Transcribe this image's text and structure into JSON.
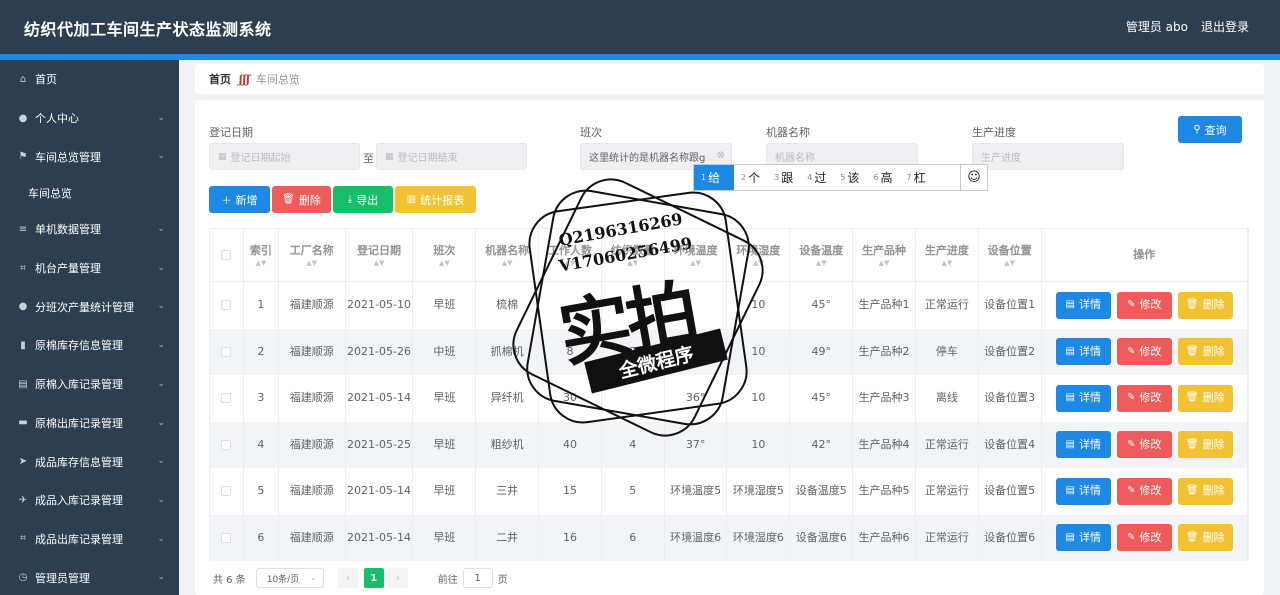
{
  "app": {
    "title": "纺织代加工车间生产状态监测系统",
    "user": "管理员 abo",
    "logout": "退出登录"
  },
  "sidebar": {
    "items": [
      {
        "label": "首页",
        "icon": "home-icon",
        "glyph": "⌂",
        "arrow": false,
        "sub": false
      },
      {
        "label": "个人中心",
        "icon": "user-icon",
        "glyph": "●",
        "arrow": true,
        "sub": false
      },
      {
        "label": "车间总览管理",
        "icon": "flag-icon",
        "glyph": "⚑",
        "arrow": true,
        "sub": false
      },
      {
        "label": "车间总览",
        "icon": "",
        "glyph": "",
        "arrow": false,
        "sub": true
      },
      {
        "label": "单机数据管理",
        "icon": "list-icon",
        "glyph": "≡",
        "arrow": true,
        "sub": false
      },
      {
        "label": "机台产量管理",
        "icon": "crop-icon",
        "glyph": "⌗",
        "arrow": true,
        "sub": false
      },
      {
        "label": "分班次产量统计管理",
        "icon": "user-icon",
        "glyph": "●",
        "arrow": true,
        "sub": false
      },
      {
        "label": "原棉库存信息管理",
        "icon": "mic-icon",
        "glyph": "▮",
        "arrow": true,
        "sub": false
      },
      {
        "label": "原棉入库记录管理",
        "icon": "cart-icon",
        "glyph": "▤",
        "arrow": true,
        "sub": false
      },
      {
        "label": "原棉出库记录管理",
        "icon": "chat-icon",
        "glyph": "▬",
        "arrow": true,
        "sub": false
      },
      {
        "label": "成品库存信息管理",
        "icon": "send-icon",
        "glyph": "➤",
        "arrow": true,
        "sub": false
      },
      {
        "label": "成品入库记录管理",
        "icon": "plane-icon",
        "glyph": "✈",
        "arrow": true,
        "sub": false
      },
      {
        "label": "成品出库记录管理",
        "icon": "crop-icon",
        "glyph": "⌗",
        "arrow": true,
        "sub": false
      },
      {
        "label": "管理员管理",
        "icon": "clock-icon",
        "glyph": "◷",
        "arrow": true,
        "sub": false
      }
    ],
    "arrow_glyph": "⌄"
  },
  "breadcrumb": {
    "home": "首页",
    "sep": "ʃʃʃ",
    "current": "车间总览"
  },
  "filters": {
    "date_label": "登记日期",
    "date_start_placeholder": "登记日期起始",
    "date_to": "至",
    "date_end_placeholder": "登记日期结束",
    "shift_label": "班次",
    "shift_value": "这里统计的是机器名称跟g",
    "machine_label": "机器名称",
    "machine_placeholder": "机器名称",
    "progress_label": "生产进度",
    "progress_placeholder": "生产进度",
    "query": "查询"
  },
  "ime": {
    "candidates": [
      {
        "n": "1",
        "t": "给"
      },
      {
        "n": "2",
        "t": "个"
      },
      {
        "n": "3",
        "t": "跟"
      },
      {
        "n": "4",
        "t": "过"
      },
      {
        "n": "5",
        "t": "该"
      },
      {
        "n": "6",
        "t": "高"
      },
      {
        "n": "7",
        "t": "杠"
      }
    ],
    "emoji": "☺"
  },
  "toolbar": {
    "add": "新增",
    "delete": "删除",
    "export": "导出",
    "report": "统计报表"
  },
  "table": {
    "columns": [
      "索引",
      "工厂名称",
      "登记日期",
      "班次",
      "机器名称",
      "工作人数",
      "纺织数量",
      "环境温度",
      "环境湿度",
      "设备温度",
      "生产品种",
      "生产进度",
      "设备位置",
      "操作"
    ],
    "rows": [
      [
        "1",
        "福建顺源",
        "2021-05-10",
        "早班",
        "梳棉",
        "",
        "2",
        "",
        "10",
        "45°",
        "生产品种1",
        "正常运行",
        "设备位置1"
      ],
      [
        "2",
        "福建顺源",
        "2021-05-26",
        "中班",
        "抓棉机",
        "8",
        "3",
        "",
        "10",
        "49°",
        "生产品种2",
        "停车",
        "设备位置2"
      ],
      [
        "3",
        "福建顺源",
        "2021-05-14",
        "早班",
        "异纤机",
        "30",
        "",
        "36°",
        "10",
        "45°",
        "生产品种3",
        "离线",
        "设备位置3"
      ],
      [
        "4",
        "福建顺源",
        "2021-05-25",
        "早班",
        "粗纱机",
        "40",
        "4",
        "37°",
        "10",
        "42°",
        "生产品种4",
        "正常运行",
        "设备位置4"
      ],
      [
        "5",
        "福建顺源",
        "2021-05-14",
        "早班",
        "三井",
        "15",
        "5",
        "环境温度5",
        "环境湿度5",
        "设备温度5",
        "生产品种5",
        "正常运行",
        "设备位置5"
      ],
      [
        "6",
        "福建顺源",
        "2021-05-14",
        "早班",
        "二井",
        "16",
        "6",
        "环境温度6",
        "环境湿度6",
        "设备温度6",
        "生产品种6",
        "正常运行",
        "设备位置6"
      ]
    ],
    "actions": {
      "detail": "详情",
      "edit": "修改",
      "delete": "删除"
    }
  },
  "pagination": {
    "total": "共 6 条",
    "page_size": "10条/页",
    "prev": "‹",
    "current": "1",
    "next": "›",
    "goto_label": "前往",
    "goto_value": "1",
    "page_suffix": "页"
  },
  "watermark": {
    "qq": "Q2196316269",
    "vx": "V17060256499",
    "big": "实拍",
    "ribbon": "全微程序"
  },
  "colors": {
    "header": "#2c3e50",
    "accent": "#1e88e5",
    "danger": "#ef5b5b",
    "success": "#19be6b",
    "warning": "#f3c233"
  }
}
